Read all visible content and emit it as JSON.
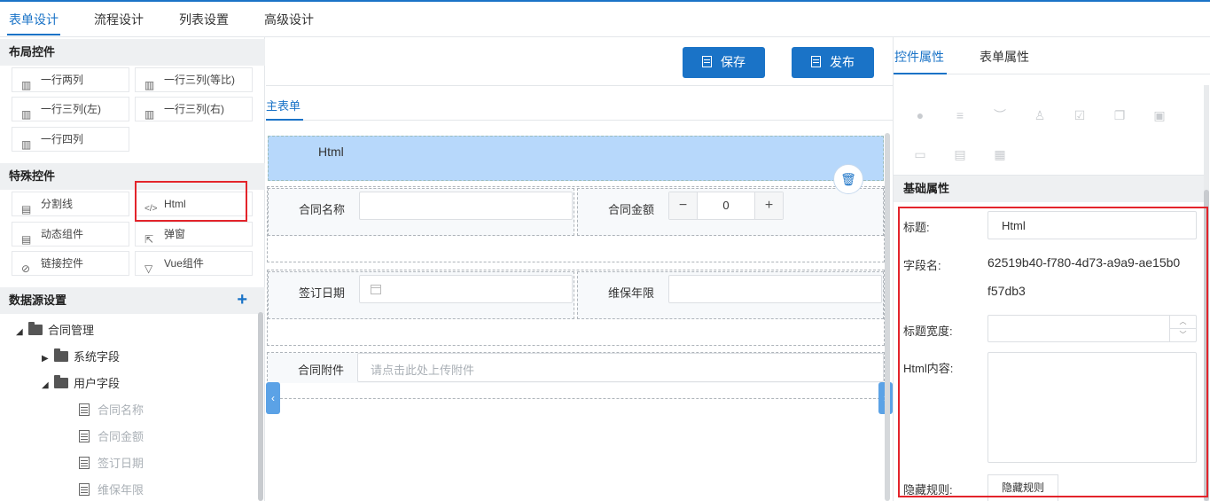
{
  "top_tabs": [
    {
      "label": "表单设计",
      "active": true
    },
    {
      "label": "流程设计",
      "active": false
    },
    {
      "label": "列表设置",
      "active": false
    },
    {
      "label": "高级设计",
      "active": false
    }
  ],
  "left": {
    "layout_title": "布局控件",
    "layout_controls": [
      "一行两列",
      "一行三列(等比)",
      "一行三列(左)",
      "一行三列(右)",
      "一行四列"
    ],
    "special_title": "特殊控件",
    "special_controls": [
      "分割线",
      "Html",
      "动态组件",
      "弹窗",
      "链接控件",
      "Vue组件"
    ],
    "datasource_title": "数据源设置",
    "add_symbol": "+",
    "tree": {
      "root": "合同管理",
      "system": "系统字段",
      "user": "用户字段",
      "fields": [
        "合同名称",
        "合同金额",
        "签订日期",
        "维保年限"
      ]
    }
  },
  "middle": {
    "save_label": "保存",
    "publish_label": "发布",
    "main_tab": "主表单",
    "html_block_label": "Html",
    "fields": {
      "contract_name": "合同名称",
      "contract_amount": "合同金额",
      "amount_value": "0",
      "minus": "−",
      "plus": "+",
      "sign_date": "签订日期",
      "maintenance_years": "维保年限",
      "attachment": "合同附件",
      "attachment_placeholder": "请点击此处上传附件"
    }
  },
  "right": {
    "tabs": [
      {
        "label": "控件属性",
        "active": true
      },
      {
        "label": "表单属性",
        "active": false
      }
    ],
    "base_title": "基础属性",
    "title_label": "标题:",
    "title_value": "Html",
    "field_label": "字段名:",
    "field_value_line1": "62519b40-f780-4d73-a9a9-ae15b0",
    "field_value_line2": "f57db3",
    "title_width_label": "标题宽度:",
    "html_content_label": "Html内容:",
    "hide_rule_label": "隐藏规则:",
    "hide_rule_button": "隐藏规则"
  },
  "colors": {
    "accent": "#1a73c7",
    "highlight": "#b7d8fb",
    "annotation": "#e3242b"
  }
}
